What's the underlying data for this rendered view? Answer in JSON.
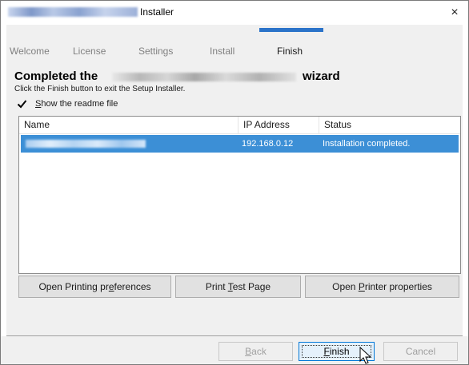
{
  "window": {
    "title_suffix": "Installer",
    "close_glyph": "×"
  },
  "steps": [
    {
      "label": "Welcome",
      "current": false
    },
    {
      "label": "License",
      "current": false
    },
    {
      "label": "Settings",
      "current": false
    },
    {
      "label": "Install",
      "current": false
    },
    {
      "label": "Finish",
      "current": true
    }
  ],
  "header": {
    "heading_prefix": "Completed the",
    "heading_suffix": "wizard",
    "subtitle": "Click the Finish button to exit the Setup Installer."
  },
  "readme": {
    "checked": true,
    "mnemonic": "S",
    "label_rest": "how the readme file"
  },
  "list": {
    "columns": [
      "Name",
      "IP Address",
      "Status"
    ],
    "rows": [
      {
        "ip": "192.168.0.12",
        "status": "Installation completed.",
        "selected": true
      }
    ]
  },
  "actions": {
    "prefs": {
      "before": "Open Printing pr",
      "mnemonic": "e",
      "after": "ferences"
    },
    "test": {
      "before": "Print ",
      "mnemonic": "T",
      "after": "est Page"
    },
    "props": {
      "before": "Open ",
      "mnemonic": "P",
      "after": "rinter properties"
    }
  },
  "footer": {
    "back": {
      "mnemonic": "B",
      "after": "ack"
    },
    "finish": {
      "mnemonic": "F",
      "after": "inish"
    },
    "cancel": "Cancel"
  },
  "icons": {
    "close": "close-icon",
    "check": "checkmark-icon",
    "cursor": "mouse-pointer-icon"
  },
  "colors": {
    "accent": "#2b73c9",
    "selection": "#3c8fd6",
    "default_button_border": "#0078d7"
  }
}
